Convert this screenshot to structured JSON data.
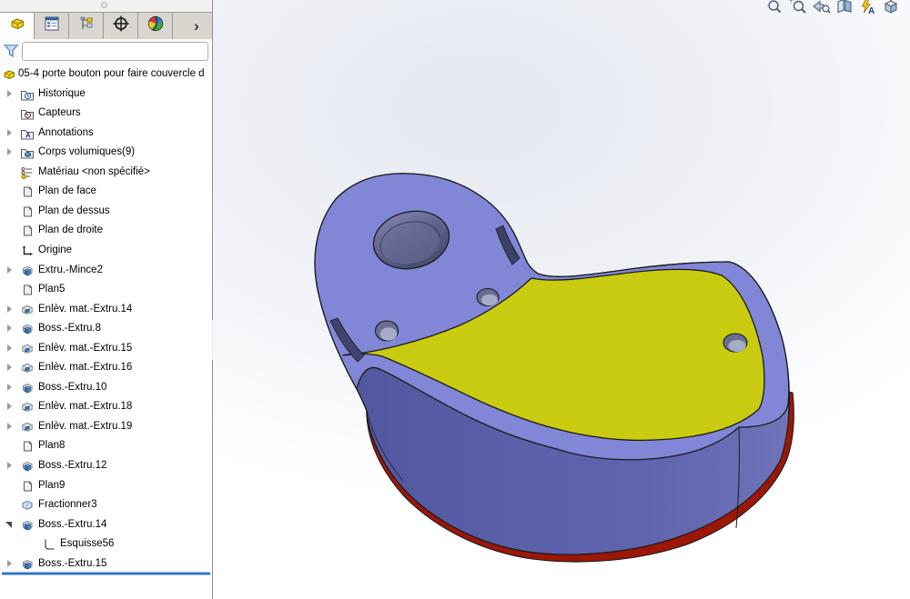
{
  "sidebar": {
    "tabs": [
      {
        "name": "featuremanager-design-tree",
        "active": true
      },
      {
        "name": "propertymanager",
        "active": false
      },
      {
        "name": "configurationmanager",
        "active": false
      },
      {
        "name": "dimxpertmanager",
        "active": false
      },
      {
        "name": "displaymanager",
        "active": false
      }
    ],
    "tabs_more_glyph": "›",
    "filter": {
      "value": "",
      "placeholder": ""
    },
    "tree": [
      {
        "label": "05-4 porte bouton pour faire couvercle d",
        "icon": "part-root",
        "indent": 0,
        "arrow": null
      },
      {
        "label": "Historique",
        "icon": "folder-history",
        "indent": 1,
        "arrow": "collapsed"
      },
      {
        "label": "Capteurs",
        "icon": "folder-sensors",
        "indent": 1,
        "arrow": null
      },
      {
        "label": "Annotations",
        "icon": "folder-annotations",
        "indent": 1,
        "arrow": "collapsed"
      },
      {
        "label": "Corps volumiques(9)",
        "icon": "folder-solid-bodies",
        "indent": 1,
        "arrow": "collapsed"
      },
      {
        "label": "Matériau <non spécifié>",
        "icon": "material",
        "indent": 1,
        "arrow": null
      },
      {
        "label": "Plan de face",
        "icon": "plane",
        "indent": 1,
        "arrow": null
      },
      {
        "label": "Plan de dessus",
        "icon": "plane",
        "indent": 1,
        "arrow": null
      },
      {
        "label": "Plan de droite",
        "icon": "plane",
        "indent": 1,
        "arrow": null
      },
      {
        "label": "Origine",
        "icon": "origin",
        "indent": 1,
        "arrow": null
      },
      {
        "label": "Extru.-Mince2",
        "icon": "boss-extrude",
        "indent": 1,
        "arrow": "collapsed"
      },
      {
        "label": "Plan5",
        "icon": "plane",
        "indent": 1,
        "arrow": null
      },
      {
        "label": "Enlèv. mat.-Extru.14",
        "icon": "cut-extrude",
        "indent": 1,
        "arrow": "collapsed"
      },
      {
        "label": "Boss.-Extru.8",
        "icon": "boss-extrude",
        "indent": 1,
        "arrow": "collapsed"
      },
      {
        "label": "Enlèv. mat.-Extru.15",
        "icon": "cut-extrude",
        "indent": 1,
        "arrow": "collapsed"
      },
      {
        "label": "Enlèv. mat.-Extru.16",
        "icon": "cut-extrude",
        "indent": 1,
        "arrow": "collapsed"
      },
      {
        "label": "Boss.-Extru.10",
        "icon": "boss-extrude",
        "indent": 1,
        "arrow": "collapsed"
      },
      {
        "label": "Enlèv. mat.-Extru.18",
        "icon": "cut-extrude",
        "indent": 1,
        "arrow": "collapsed"
      },
      {
        "label": "Enlèv. mat.-Extru.19",
        "icon": "cut-extrude",
        "indent": 1,
        "arrow": "collapsed"
      },
      {
        "label": "Plan8",
        "icon": "plane",
        "indent": 1,
        "arrow": null
      },
      {
        "label": "Boss.-Extru.12",
        "icon": "boss-extrude",
        "indent": 1,
        "arrow": "collapsed"
      },
      {
        "label": "Plan9",
        "icon": "plane",
        "indent": 1,
        "arrow": null
      },
      {
        "label": "Fractionner3",
        "icon": "split",
        "indent": 1,
        "arrow": null
      },
      {
        "label": "Boss.-Extru.14",
        "icon": "boss-extrude",
        "indent": 1,
        "arrow": "expanded"
      },
      {
        "label": "Esquisse56",
        "icon": "sketch",
        "indent": 2,
        "arrow": null
      },
      {
        "label": "Boss.-Extru.15",
        "icon": "boss-extrude",
        "indent": 1,
        "arrow": "collapsed"
      }
    ]
  },
  "headsup_toolbar": {
    "icons": [
      {
        "name": "zoom-to-fit"
      },
      {
        "name": "zoom-to-area"
      },
      {
        "name": "previous-view"
      },
      {
        "name": "section-view"
      },
      {
        "name": "dynamic-annotation-views"
      },
      {
        "name": "view-orientation"
      }
    ]
  },
  "model": {
    "colors": {
      "top_face": "#8186d6",
      "side_wall": "#6065b2",
      "inset_face": "#c9cb11",
      "bottom_rim": "#9c1708",
      "bore_dark": "#52567e",
      "bore_mid": "#6b6f99",
      "hole_dark": "#696e92",
      "hole_light": "#a6abc8",
      "edge": "#1b1b1b"
    }
  }
}
